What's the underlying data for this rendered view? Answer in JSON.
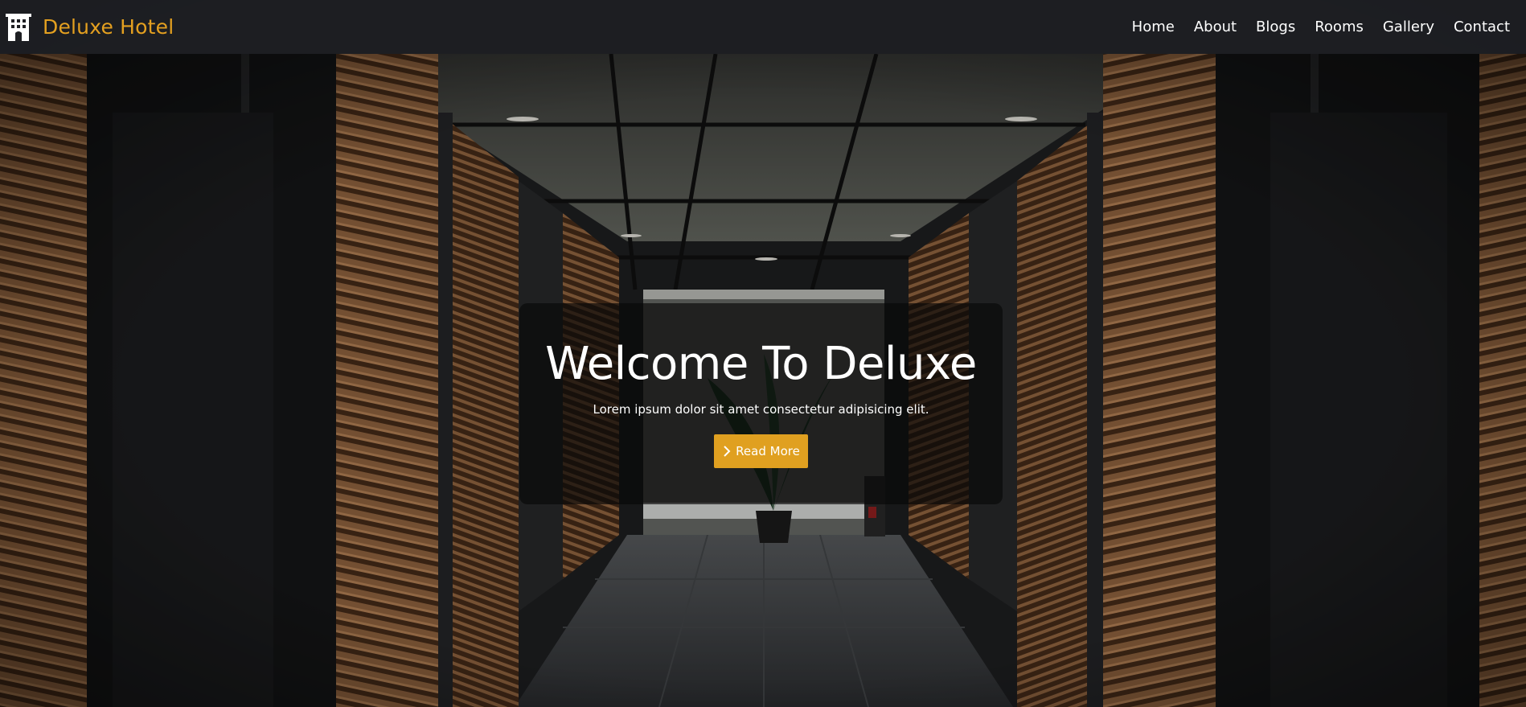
{
  "brand": {
    "name": "Deluxe Hotel",
    "icon": "hotel-building-icon",
    "color": "#e4a020"
  },
  "nav": {
    "links": [
      {
        "label": "Home"
      },
      {
        "label": "About"
      },
      {
        "label": "Blogs"
      },
      {
        "label": "Rooms"
      },
      {
        "label": "Gallery"
      },
      {
        "label": "Contact"
      }
    ]
  },
  "hero": {
    "title": "Welcome To Deluxe",
    "subtitle": "Lorem ipsum dolor sit amet consectetur adipisicing elit.",
    "button": {
      "label": "Read More",
      "icon": "chevron-right-icon",
      "color": "#e0a020"
    },
    "background": "elevator-corridor-photo"
  }
}
